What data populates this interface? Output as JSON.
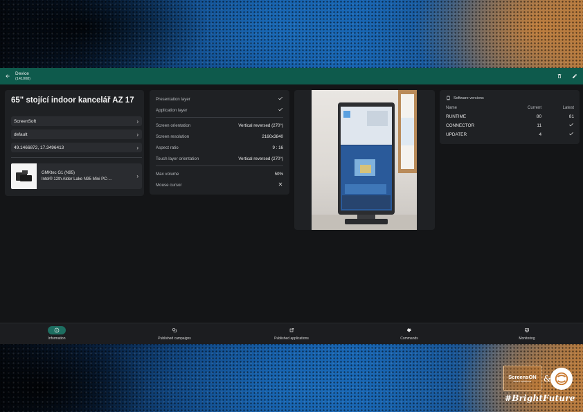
{
  "topbar": {
    "title": "Device",
    "subtitle": "(141008)"
  },
  "device": {
    "title": "65\" stojící indoor kancelář AZ 17",
    "links": [
      "ScreenSoft",
      "default",
      "49.1466872, 17.3496413"
    ],
    "hardware": {
      "name": "GMKtec G1 (N95)",
      "description": "Intel® 12th Alder Lake N95 Mini PC-..."
    }
  },
  "settings": {
    "group1": [
      {
        "label": "Presentation layer",
        "value": "check"
      },
      {
        "label": "Application layer",
        "value": "check"
      }
    ],
    "group2": [
      {
        "label": "Screen orientation",
        "value": "Vertical reversed (270°)"
      },
      {
        "label": "Screen resolution",
        "value": "2160x3840"
      },
      {
        "label": "Aspect ratio",
        "value": "9 : 16"
      },
      {
        "label": "Touch layer orientation",
        "value": "Vertical reversed (270°)"
      }
    ],
    "group3": [
      {
        "label": "Max volume",
        "value": "50%"
      },
      {
        "label": "Mouse cursor",
        "value": "cross"
      }
    ]
  },
  "software": {
    "title": "Software versions",
    "headers": [
      "Name",
      "Current",
      "Latest"
    ],
    "rows": [
      {
        "name": "RUNTIME",
        "current": "80",
        "latest": "81"
      },
      {
        "name": "CONNECTOR",
        "current": "11",
        "latest": "check"
      },
      {
        "name": "UPDATER",
        "current": "4",
        "latest": "check"
      }
    ]
  },
  "nav": {
    "items": [
      {
        "label": "Information",
        "icon": "info-icon",
        "active": true
      },
      {
        "label": "Published campaigns",
        "icon": "campaigns-icon",
        "active": false
      },
      {
        "label": "Published applications",
        "icon": "applications-icon",
        "active": false
      },
      {
        "label": "Commands",
        "icon": "commands-icon",
        "active": false
      },
      {
        "label": "Monitoring",
        "icon": "monitoring-icon",
        "active": false
      }
    ]
  },
  "brand": {
    "name": "ScreensON",
    "sub": "smart solutions",
    "amp": "&",
    "tag": "#BrightFuture"
  },
  "colors": {
    "topbar": "#0e5a4c",
    "active_pill": "#1d6e61",
    "card": "#1f2124",
    "app_bg": "#141517"
  }
}
